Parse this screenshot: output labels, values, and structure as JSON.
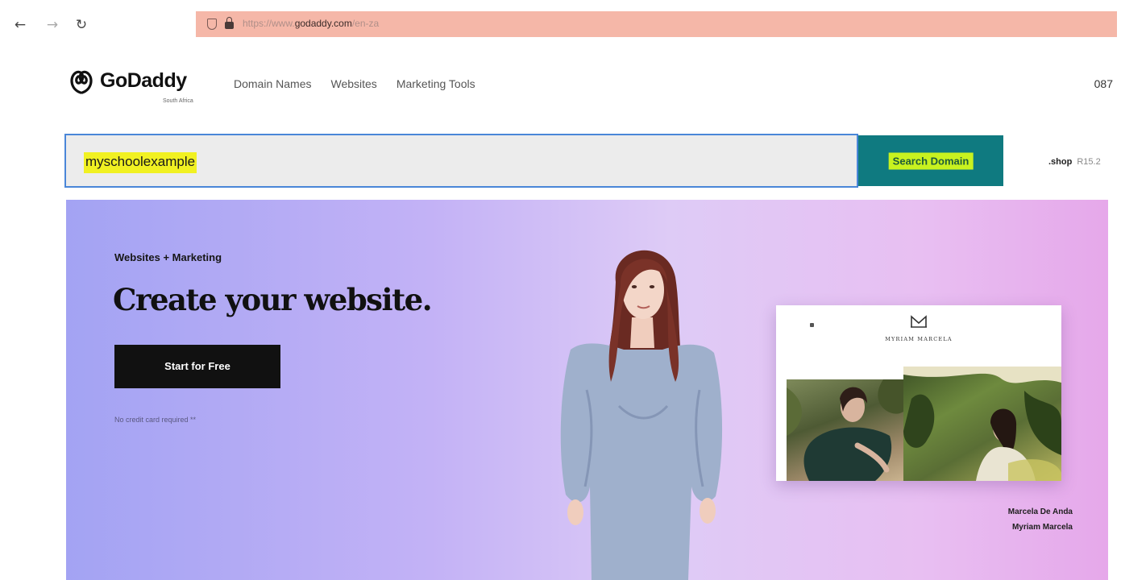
{
  "browser": {
    "url_prefix": "https://www.",
    "url_domain": "godaddy.com",
    "url_path": "/en-za",
    "back_icon": "arrow-left",
    "forward_icon": "arrow-right",
    "reload_icon": "reload"
  },
  "header": {
    "logo_text": "GoDaddy",
    "logo_region": "South Africa",
    "nav": [
      "Domain Names",
      "Websites",
      "Marketing Tools"
    ],
    "phone": "087"
  },
  "search": {
    "value": "myschoolexample",
    "button_label": "Search Domain",
    "tld": ".shop",
    "tld_price": "R15.2"
  },
  "hero": {
    "eyebrow": "Websites + Marketing",
    "title": "Create your website.",
    "cta_label": "Start for Free",
    "disclaimer": "No credit card required **",
    "preview_brand": "MYRIAM MARCELA",
    "caption_name": "Marcela De Anda",
    "caption_business": "Myriam Marcela"
  },
  "colors": {
    "search_button": "#0f7a80",
    "highlight": "#f1f122",
    "button_highlight": "#c8f21f",
    "cta": "#111111",
    "hero_start": "#a3a3f3",
    "hero_end": "#e6a8ea"
  }
}
